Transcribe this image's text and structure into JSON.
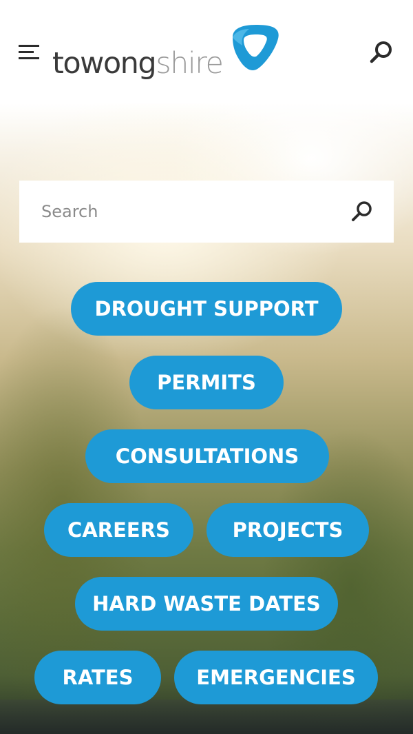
{
  "header": {
    "logo_part1": "towong",
    "logo_part2": "shire",
    "menu_icon": "hamburger-menu-icon",
    "search_icon": "magnifier-icon"
  },
  "search": {
    "placeholder": "Search",
    "value": "",
    "submit_icon": "magnifier-icon"
  },
  "quick_links": {
    "drought_support": "DROUGHT SUPPORT",
    "permits": "PERMITS",
    "consultations": "CONSULTATIONS",
    "careers": "CAREERS",
    "projects": "PROJECTS",
    "hard_waste_dates": "HARD WASTE DATES",
    "rates": "RATES",
    "emergencies": "EMERGENCIES"
  },
  "colors": {
    "accent": "#1e9ad6",
    "logo_dark": "#3a3a3a",
    "logo_light": "#9a9a9a"
  }
}
